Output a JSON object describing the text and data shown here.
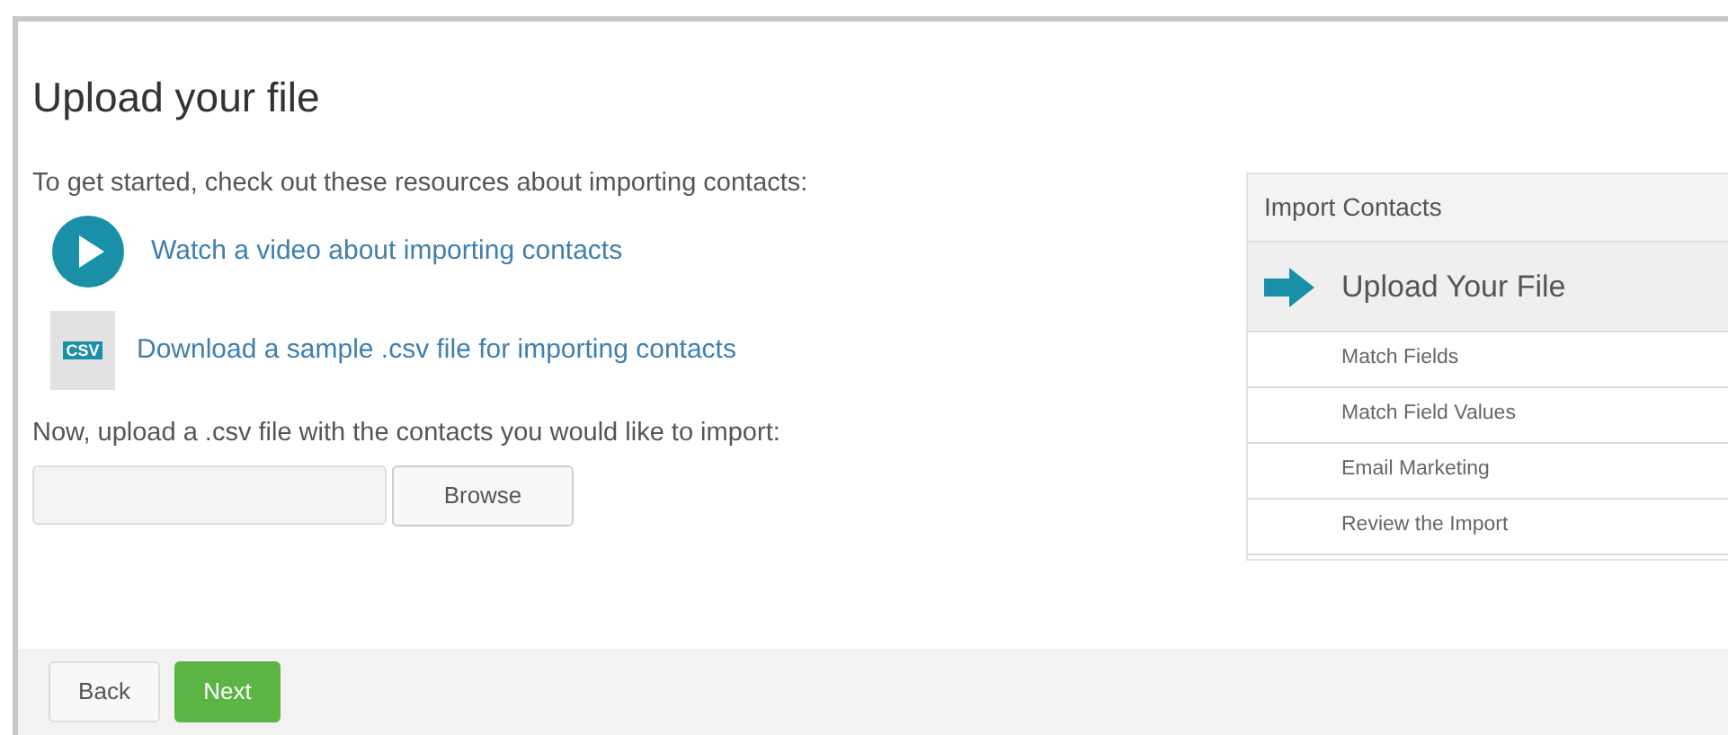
{
  "title": "Upload your file",
  "intro": "To get started, check out these resources about importing contacts:",
  "resources": [
    {
      "kind": "video",
      "label": "Watch a video about importing contacts"
    },
    {
      "kind": "csv",
      "badge": "CSV",
      "label": "Download a sample .csv file for importing contacts"
    }
  ],
  "upload_prompt": "Now, upload a .csv file with the contacts you would like to import:",
  "file_field": {
    "browse": "Browse"
  },
  "steps_panel": {
    "title": "Import Contacts",
    "steps": [
      {
        "label": "Upload Your File",
        "selected": true
      },
      {
        "label": "Match Fields",
        "selected": false
      },
      {
        "label": "Match Field Values",
        "selected": false
      },
      {
        "label": "Email Marketing",
        "selected": false
      },
      {
        "label": "Review the Import",
        "selected": false
      }
    ]
  },
  "footer": {
    "back": "Back",
    "next": "Next"
  }
}
